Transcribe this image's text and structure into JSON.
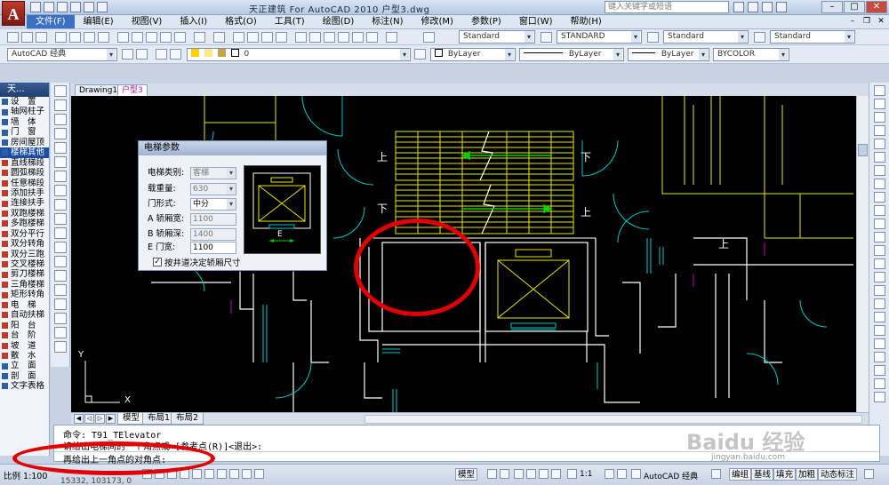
{
  "window": {
    "title": "天正建筑 For AutoCAD 2010      户型3.dwg",
    "search_placeholder": "键入关键字或短语"
  },
  "menu": [
    "文件(F)",
    "编辑(E)",
    "视图(V)",
    "插入(I)",
    "格式(O)",
    "工具(T)",
    "绘图(D)",
    "标注(N)",
    "修改(M)",
    "参数(P)",
    "窗口(W)",
    "帮助(H)"
  ],
  "toolbar1": {
    "text_style": "Standard",
    "dim_style": "STANDARD",
    "table_style": "Standard",
    "multileader_style": "Standard"
  },
  "toolbar2": {
    "workspace": "AutoCAD 经典",
    "layer": "0",
    "color": "ByLayer",
    "linetype": "ByLayer",
    "lineweight": "ByLayer",
    "plotstyle": "BYCOLOR"
  },
  "left_panel": {
    "title": "天...",
    "items": [
      {
        "label": "设　置",
        "type": "group"
      },
      {
        "label": "轴网柱子",
        "type": "group"
      },
      {
        "label": "墙　体",
        "type": "group"
      },
      {
        "label": "门　窗",
        "type": "group"
      },
      {
        "label": "房间屋顶",
        "type": "group"
      },
      {
        "label": "楼梯其他",
        "type": "group",
        "highlighted": true
      },
      {
        "label": "直线梯段",
        "type": "sub"
      },
      {
        "label": "圆弧梯段",
        "type": "sub"
      },
      {
        "label": "任意梯段",
        "type": "sub"
      },
      {
        "label": "添加扶手",
        "type": "sub"
      },
      {
        "label": "连接扶手",
        "type": "sub"
      },
      {
        "label": "双跑楼梯",
        "type": "sub"
      },
      {
        "label": "多跑楼梯",
        "type": "sub"
      },
      {
        "label": "双分平行",
        "type": "sub"
      },
      {
        "label": "双分转角",
        "type": "sub"
      },
      {
        "label": "双分三跑",
        "type": "sub"
      },
      {
        "label": "交叉楼梯",
        "type": "sub"
      },
      {
        "label": "剪刀楼梯",
        "type": "sub"
      },
      {
        "label": "三角楼梯",
        "type": "sub"
      },
      {
        "label": "矩形转角",
        "type": "sub"
      },
      {
        "label": "电　梯",
        "type": "sub"
      },
      {
        "label": "自动扶梯",
        "type": "sub"
      },
      {
        "label": "阳　台",
        "type": "sub"
      },
      {
        "label": "台　阶",
        "type": "sub"
      },
      {
        "label": "坡　道",
        "type": "sub"
      },
      {
        "label": "散　水",
        "type": "sub"
      },
      {
        "label": "立　面",
        "type": "group"
      },
      {
        "label": "剖　面",
        "type": "group"
      },
      {
        "label": "文字表格",
        "type": "group"
      }
    ]
  },
  "doc_tabs": [
    "Drawing1",
    "户型3"
  ],
  "drawing": {
    "labels": {
      "up": "上",
      "down": "下"
    },
    "axis": {
      "x": "X",
      "y": "Y"
    },
    "dim_e": "E"
  },
  "dialog": {
    "title": "电梯参数",
    "fields": [
      {
        "label": "电梯类别:",
        "value": "客梯",
        "type": "select",
        "editable": false
      },
      {
        "label": "载重量:",
        "value": "630",
        "type": "select",
        "editable": false
      },
      {
        "label": "门形式:",
        "value": "中分",
        "type": "select",
        "editable": true
      },
      {
        "label": "A 轿厢宽:",
        "value": "1100",
        "type": "input",
        "editable": false
      },
      {
        "label": "B 轿厢深:",
        "value": "1400",
        "type": "input",
        "editable": false
      },
      {
        "label": "E 门宽:",
        "value": "1100",
        "type": "input",
        "editable": true
      }
    ],
    "checkbox_label": "按井道决定轿厢尺寸",
    "checkbox_checked": true
  },
  "layout_tabs": [
    "模型",
    "布局1",
    "布局2"
  ],
  "command": {
    "line1": "命令: T91_TElevator",
    "line2": "请给出电梯间的一个角点或 [参考点(R)]<退出>:",
    "line3": "再给出上一角点的对角点:"
  },
  "status": {
    "scale": "比例 1:100",
    "coords": "15332, 103173, 0",
    "model": "模型",
    "anno_scale": "1:1",
    "workspace": "AutoCAD 经典",
    "buttons": [
      "编组",
      "基线",
      "填充",
      "加粗",
      "动态标注"
    ]
  },
  "watermark": {
    "brand": "Baidu 经验",
    "url": "jingyan.baidu.com"
  },
  "colors": {
    "cad_bg": "#000000",
    "wall": "#ffffff",
    "stair": "#e6e600",
    "door": "#00c8c8",
    "arrow": "#00d000",
    "annotation": "#e00000"
  }
}
